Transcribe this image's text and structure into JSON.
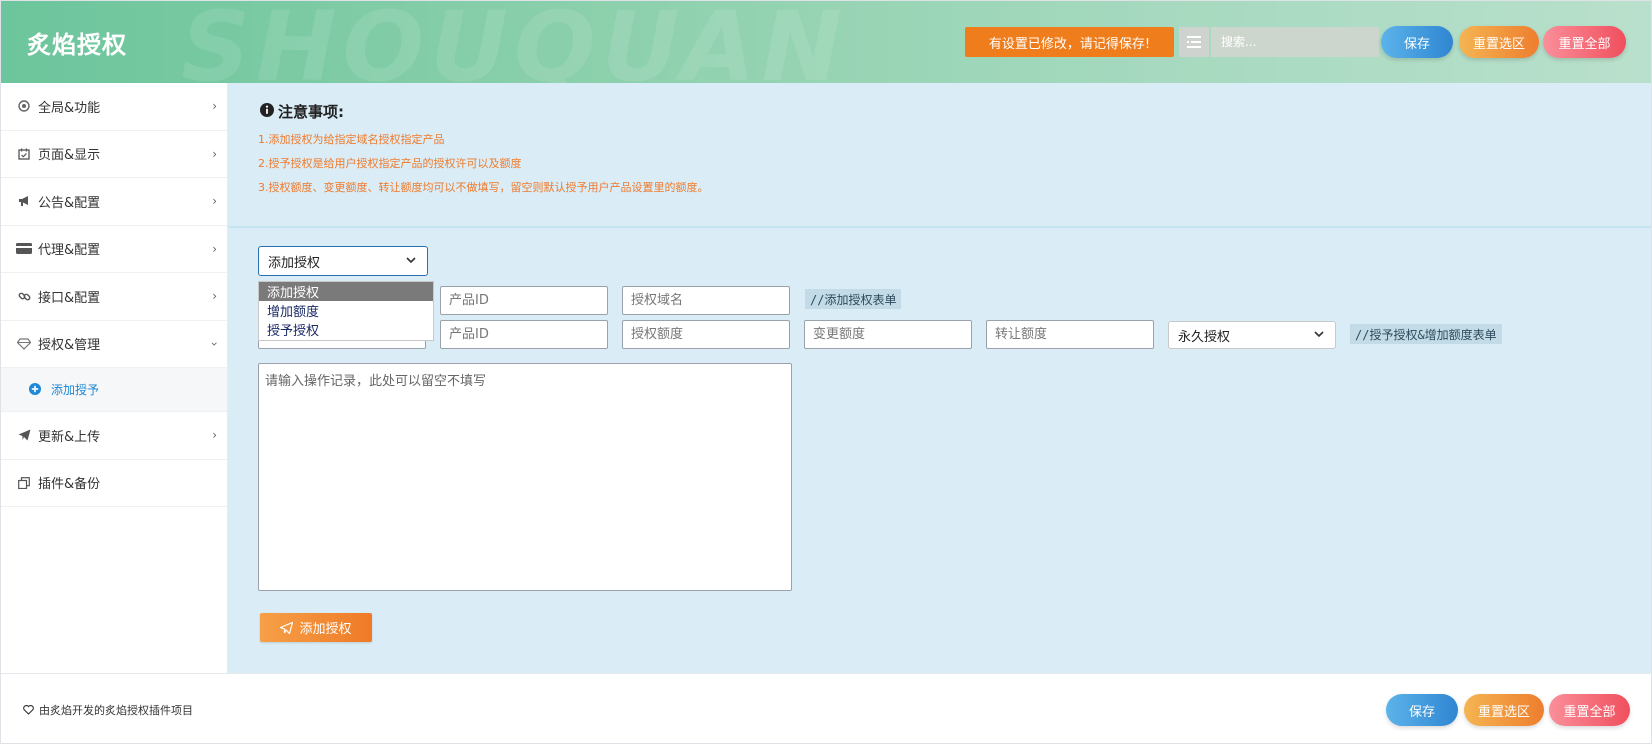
{
  "header": {
    "brand": "炙焰授权",
    "watermark": "SHOUQUAN",
    "notice": "有设置已修改，请记得保存!",
    "search_placeholder": "搜索...",
    "save": "保存",
    "reset_section": "重置选区",
    "reset_all": "重置全部"
  },
  "sidebar": {
    "items": [
      {
        "label": "全局&功能",
        "icon": "target-icon"
      },
      {
        "label": "页面&显示",
        "icon": "calendar-check-icon"
      },
      {
        "label": "公告&配置",
        "icon": "bullhorn-icon"
      },
      {
        "label": "代理&配置",
        "icon": "credit-card-icon"
      },
      {
        "label": "接口&配置",
        "icon": "link-icon"
      },
      {
        "label": "授权&管理",
        "icon": "gem-icon"
      },
      {
        "label": "更新&上传",
        "icon": "paper-plane-icon"
      },
      {
        "label": "插件&备份",
        "icon": "copy-icon"
      }
    ],
    "sub_item": "添加授予"
  },
  "notes": {
    "title": "注意事项:",
    "lines": [
      "1.添加授权为给指定域名授权指定产品",
      "2.授予授权是给用户授权指定产品的授权许可以及额度",
      "3.授权额度、变更额度、转让额度均可以不做填写，留空则默认授予用户产品设置里的额度。"
    ]
  },
  "form": {
    "action_select": {
      "value": "添加授权",
      "options": [
        "添加授权",
        "增加额度",
        "授予授权"
      ]
    },
    "row1": {
      "product_id_placeholder": "产品ID",
      "domain_placeholder": "授权域名",
      "comment": "//添加授权表单"
    },
    "row2": {
      "product_id_placeholder": "产品ID",
      "quota_placeholder": "授权额度",
      "change_quota_placeholder": "变更额度",
      "transfer_quota_placeholder": "转让额度",
      "duration_value": "永久授权",
      "comment": "//授予授权&增加额度表单"
    },
    "log_placeholder": "请输入操作记录，此处可以留空不填写",
    "submit": "添加授权"
  },
  "footer": {
    "credit": "由炙焰开发的炙焰授权插件项目",
    "save": "保存",
    "reset_section": "重置选区",
    "reset_all": "重置全部"
  },
  "colors": {
    "accent_blue": "#2f86d1",
    "accent_orange": "#ef7a27",
    "accent_red": "#f04f5d",
    "notice_orange": "#f07d1c",
    "main_bg": "#daedf6"
  }
}
